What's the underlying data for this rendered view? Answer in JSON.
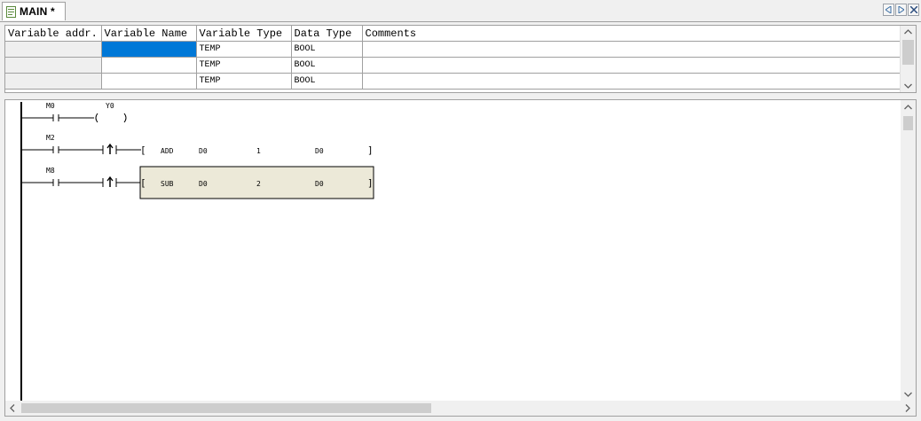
{
  "tab": {
    "title": "MAIN *"
  },
  "variables": {
    "headers": [
      "Variable addr.",
      "Variable Name",
      "Variable Type",
      "Data Type",
      "Comments"
    ],
    "rows": [
      {
        "addr": "",
        "name": "",
        "var_type": "TEMP",
        "data_type": "BOOL",
        "comment": ""
      },
      {
        "addr": "",
        "name": "",
        "var_type": "TEMP",
        "data_type": "BOOL",
        "comment": ""
      },
      {
        "addr": "",
        "name": "",
        "var_type": "TEMP",
        "data_type": "BOOL",
        "comment": ""
      }
    ]
  },
  "ladder": {
    "rung1": {
      "contact": "M0",
      "coil": "Y0"
    },
    "rung2": {
      "contact": "M2",
      "instr": "ADD",
      "op1": "D0",
      "op2": "1",
      "op3": "D0"
    },
    "rung3": {
      "contact": "M8",
      "instr": "SUB",
      "op1": "D0",
      "op2": "2",
      "op3": "D0"
    }
  },
  "colors": {
    "selection": "#0078d7",
    "selected_block": "#ece9d8"
  }
}
